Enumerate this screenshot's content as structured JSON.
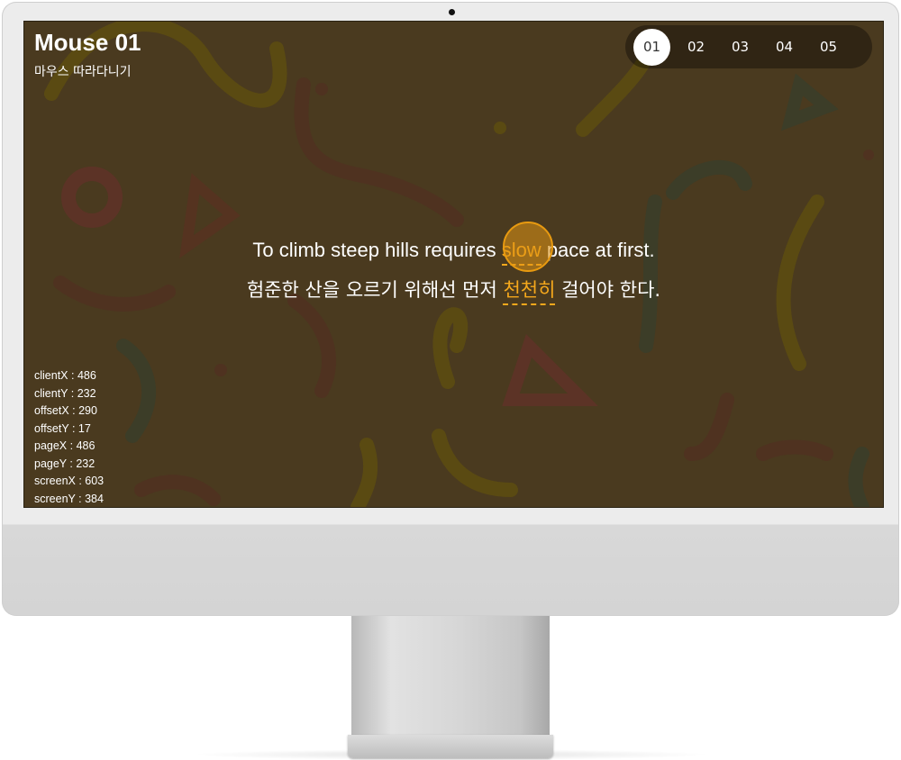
{
  "header": {
    "title": "Mouse 01",
    "subtitle": "마우스 따라다니기"
  },
  "nav": {
    "items": [
      "01",
      "02",
      "03",
      "04",
      "05"
    ],
    "active": "01"
  },
  "sentence": {
    "en_before": "To climb steep hills requires ",
    "en_highlight": "slow",
    "en_after": " pace at first.",
    "ko_before": "험준한 산을 오르기 위해선 먼저 ",
    "ko_highlight": "천천히",
    "ko_after": " 걸어야 한다."
  },
  "mouse_info": [
    {
      "label": "clientX",
      "value": "486"
    },
    {
      "label": "clientY",
      "value": "232"
    },
    {
      "label": "offsetX",
      "value": "290"
    },
    {
      "label": "offsetY",
      "value": "17"
    },
    {
      "label": "pageX",
      "value": "486"
    },
    {
      "label": "pageY",
      "value": "232"
    },
    {
      "label": "screenX",
      "value": "603"
    },
    {
      "label": "screenY",
      "value": "384"
    }
  ],
  "colors": {
    "background": "#4a3a1f",
    "accent": "#f5a81c"
  }
}
